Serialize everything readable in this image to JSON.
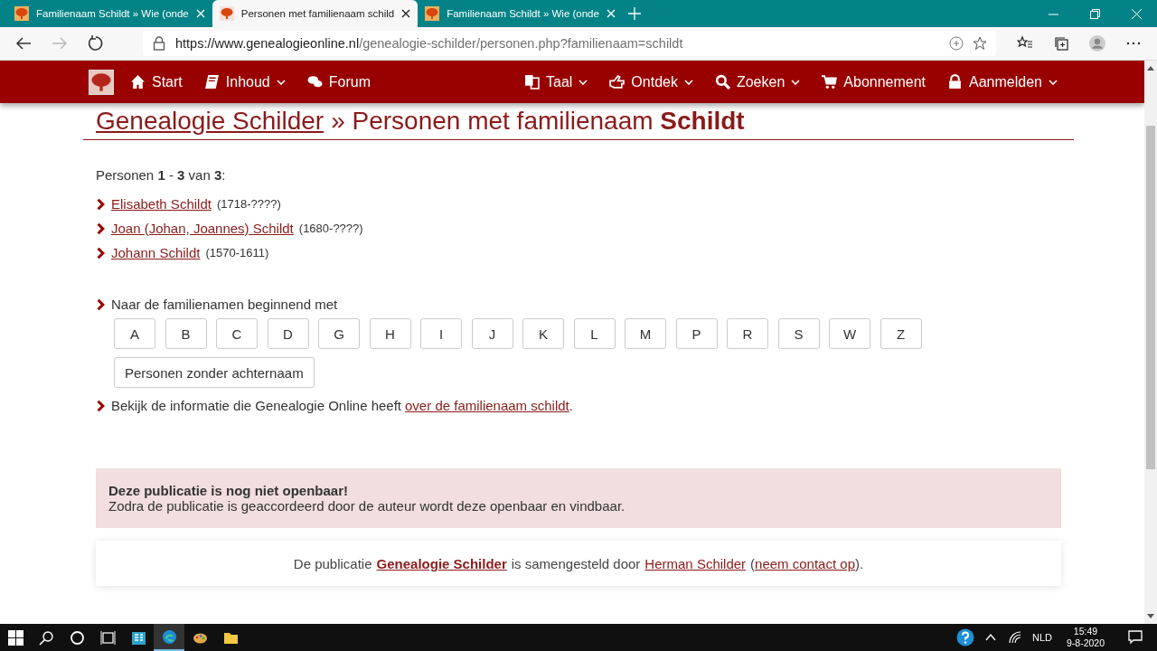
{
  "browser": {
    "tabs": [
      {
        "title": "Familienaam Schildt » Wie (onde",
        "selected": false
      },
      {
        "title": "Personen met familienaam schild",
        "selected": true
      },
      {
        "title": "Familienaam Schildt » Wie (onde",
        "selected": false
      }
    ],
    "url_host": "https://www.genealogieonline.nl",
    "url_path": "/genealogie-schilder/personen.php?familienaam=schildt"
  },
  "nav": {
    "left": [
      {
        "label": "Start",
        "dropdown": false
      },
      {
        "label": "Inhoud",
        "dropdown": true
      },
      {
        "label": "Forum",
        "dropdown": false
      }
    ],
    "right": [
      {
        "label": "Taal",
        "dropdown": true
      },
      {
        "label": "Ontdek",
        "dropdown": true
      },
      {
        "label": "Zoeken",
        "dropdown": true
      },
      {
        "label": "Abonnement",
        "dropdown": false
      },
      {
        "label": "Aanmelden",
        "dropdown": true
      }
    ]
  },
  "heading": {
    "link": "Genealogie Schilder",
    "rest": "» Personen met familienaam **Schildt**"
  },
  "count": "Personen **1** - **3** van **3**:",
  "persons": [
    {
      "name": "Elisabeth Schildt",
      "dates": "(1718-????)"
    },
    {
      "name": "Joan (Johan, Joannes) Schildt",
      "dates": "(1680-????)"
    },
    {
      "name": "Johann Schildt",
      "dates": "(1570-1611)"
    }
  ],
  "letters_intro": "Naar de familienamen beginnend met",
  "letters": [
    "A",
    "B",
    "C",
    "D",
    "G",
    "H",
    "I",
    "J",
    "K",
    "L",
    "M",
    "P",
    "R",
    "S",
    "W",
    "Z"
  ],
  "no_surname": "Personen zonder achternaam",
  "info": {
    "text": "Bekijk de informatie die Genealogie Online heeft",
    "link": "over de familienaam schildt",
    "after": "."
  },
  "notice": {
    "title": "Deze publicatie is nog niet openbaar!",
    "text": "Zodra de publicatie is geaccordeerd door de auteur wordt deze openbaar en vindbaar."
  },
  "footer": {
    "t1": "De publicatie",
    "pub": "Genealogie Schilder",
    "t2": "is samengesteld door",
    "author": "Herman Schilder",
    "contact": "neem contact op",
    "p1": "(",
    "p2": ")."
  },
  "taskbar": {
    "lang": "NLD",
    "time": "15:49",
    "date": "9-8-2020"
  }
}
